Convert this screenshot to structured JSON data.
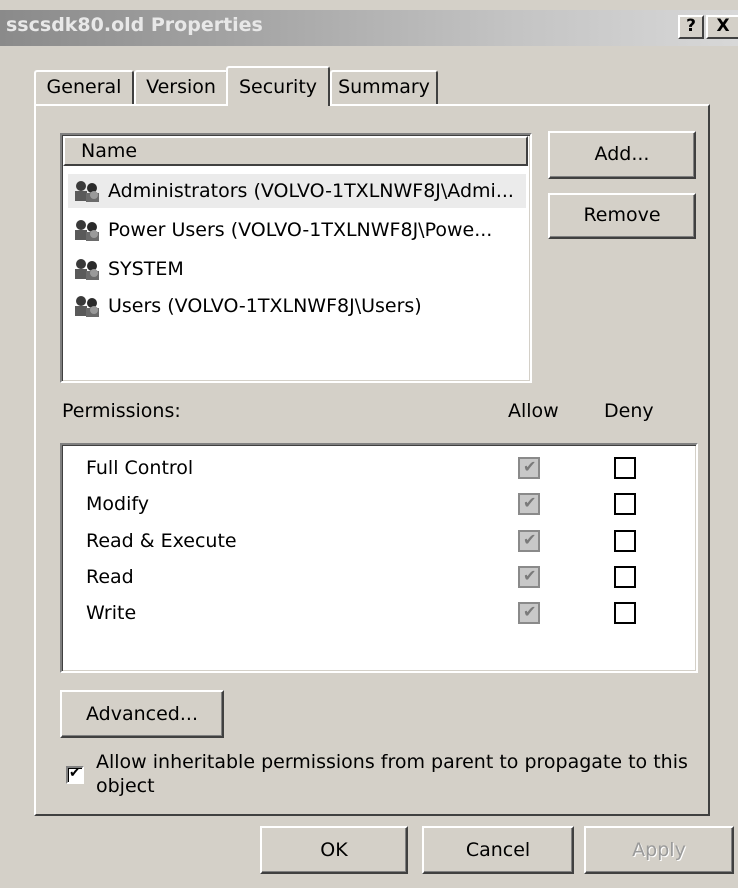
{
  "window": {
    "title": "sscsdk80.old Properties",
    "help_button": "?",
    "close_button": "X"
  },
  "tabs": [
    {
      "label": "General"
    },
    {
      "label": "Version"
    },
    {
      "label": "Security"
    },
    {
      "label": "Summary"
    }
  ],
  "active_tab": "Security",
  "groups": {
    "header": "Name",
    "items": [
      {
        "label": "Administrators (VOLVO-1TXLNWF8J\\Admi...",
        "selected": true
      },
      {
        "label": "Power Users (VOLVO-1TXLNWF8J\\Powe...",
        "selected": false
      },
      {
        "label": "SYSTEM",
        "selected": false
      },
      {
        "label": "Users (VOLVO-1TXLNWF8J\\Users)",
        "selected": false
      }
    ],
    "add_label": "Add...",
    "remove_label": "Remove"
  },
  "permissions": {
    "header": "Permissions:",
    "allow_header": "Allow",
    "deny_header": "Deny",
    "rows": [
      {
        "label": "Full Control",
        "allow": true,
        "deny": false
      },
      {
        "label": "Modify",
        "allow": true,
        "deny": false
      },
      {
        "label": "Read & Execute",
        "allow": true,
        "deny": false
      },
      {
        "label": "Read",
        "allow": true,
        "deny": false
      },
      {
        "label": "Write",
        "allow": true,
        "deny": false
      }
    ]
  },
  "advanced_label": "Advanced...",
  "inherit": {
    "checked": true,
    "line1": "Allow inheritable permissions from parent to propagate to this",
    "line2": "object"
  },
  "footer": {
    "ok_label": "OK",
    "cancel_label": "Cancel",
    "apply_label": "Apply",
    "apply_enabled": false
  },
  "colors": {
    "dialog_bg": "#d4d0c8",
    "title_gradient_start": "#8a8a8a",
    "title_gradient_end": "#d8d8d8"
  }
}
